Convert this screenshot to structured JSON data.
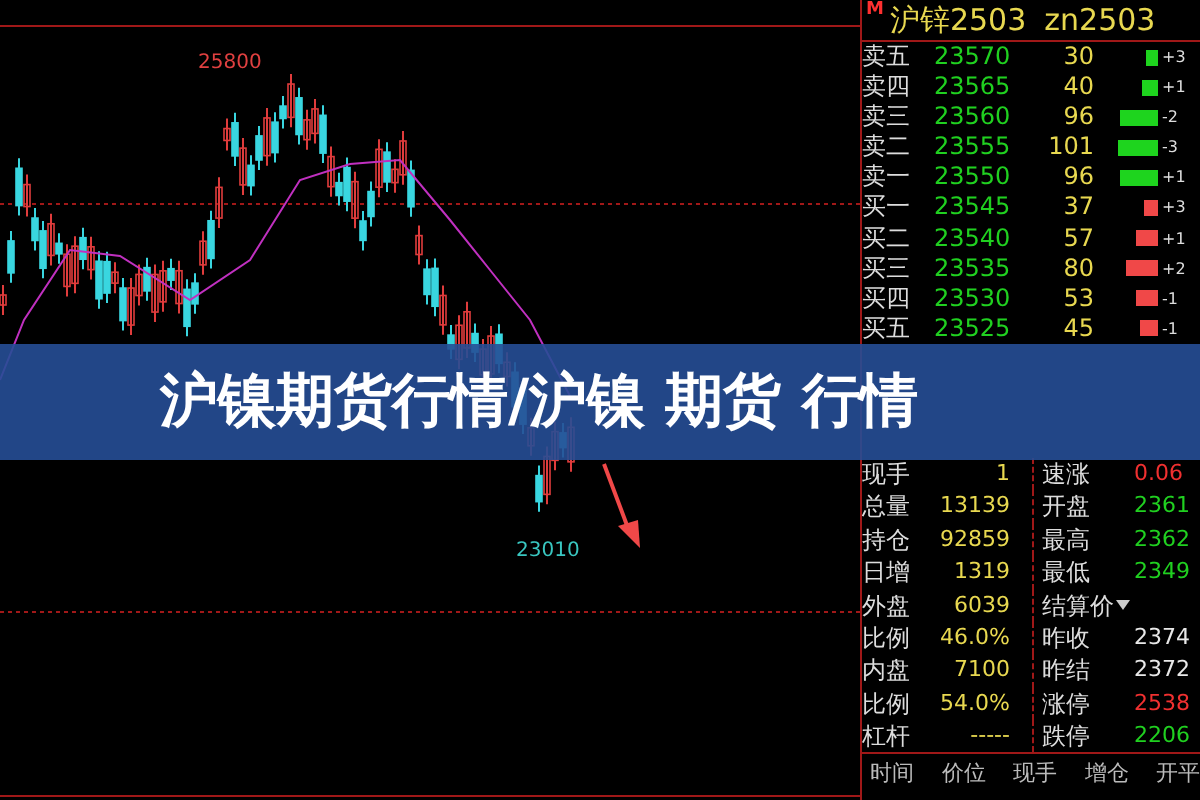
{
  "chart": {
    "high_label": "25800",
    "low_label": "23010"
  },
  "quote": {
    "badge": "M",
    "name": "沪锌2503",
    "code": "zn2503",
    "order_book": [
      {
        "label": "卖五",
        "price": "23570",
        "volume": "30",
        "kind": "sell",
        "change": "+3"
      },
      {
        "label": "卖四",
        "price": "23565",
        "volume": "40",
        "kind": "sell",
        "change": "+1"
      },
      {
        "label": "卖三",
        "price": "23560",
        "volume": "96",
        "kind": "sell",
        "change": "-2"
      },
      {
        "label": "卖二",
        "price": "23555",
        "volume": "101",
        "kind": "sell",
        "change": "-3"
      },
      {
        "label": "卖一",
        "price": "23550",
        "volume": "96",
        "kind": "sell",
        "change": "+1"
      },
      {
        "label": "买一",
        "price": "23545",
        "volume": "37",
        "kind": "buy",
        "change": "+3"
      },
      {
        "label": "买二",
        "price": "23540",
        "volume": "57",
        "kind": "buy",
        "change": "+1"
      },
      {
        "label": "买三",
        "price": "23535",
        "volume": "80",
        "kind": "buy",
        "change": "+2"
      },
      {
        "label": "买四",
        "price": "23530",
        "volume": "53",
        "kind": "buy",
        "change": "-1"
      },
      {
        "label": "买五",
        "price": "23525",
        "volume": "45",
        "kind": "buy",
        "change": "-1"
      }
    ],
    "stats": [
      {
        "label": "现手",
        "value": "1",
        "label_2": "速涨",
        "value_2": "0.06",
        "kind": "up",
        "has_menu": false
      },
      {
        "label": "总量",
        "value": "13139",
        "label_2": "开盘",
        "value_2": "2361",
        "kind": "down",
        "has_menu": false
      },
      {
        "label": "持仓",
        "value": "92859",
        "label_2": "最高",
        "value_2": "2362",
        "kind": "down",
        "has_menu": false
      },
      {
        "label": "日增",
        "value": "1319",
        "label_2": "最低",
        "value_2": "2349",
        "kind": "down",
        "has_menu": false
      },
      {
        "label": "外盘",
        "value": "6039",
        "label_2": "结算价",
        "kind": "flat",
        "has_menu": true
      },
      {
        "label": "比例",
        "value": "46.0%",
        "label_2": "昨收",
        "value_2": "2374",
        "kind": "flat",
        "has_menu": false
      },
      {
        "label": "内盘",
        "value": "7100",
        "label_2": "昨结",
        "value_2": "2372",
        "kind": "flat",
        "has_menu": false
      },
      {
        "label": "比例",
        "value": "54.0%",
        "label_2": "涨停",
        "value_2": "2538",
        "kind": "up",
        "has_menu": false
      },
      {
        "label": "杠杆",
        "value": "-----",
        "label_2": "跌停",
        "value_2": "2206",
        "kind": "down",
        "has_menu": false
      }
    ],
    "trades_header": [
      "时间",
      "价位",
      "现手",
      "增仓",
      "开平"
    ]
  },
  "banner": {
    "text": "沪镍期货行情/沪镍 期货 行情"
  }
}
